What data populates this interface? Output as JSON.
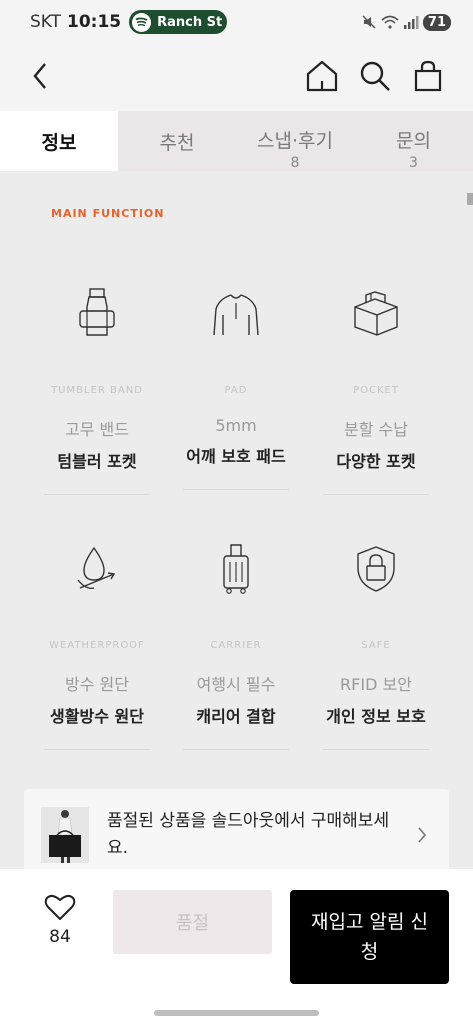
{
  "status": {
    "carrier": "SKT",
    "time": "10:15",
    "media": "Ranch St",
    "battery": "71"
  },
  "tabs": [
    {
      "label": "정보",
      "count": ""
    },
    {
      "label": "추천",
      "count": ""
    },
    {
      "label": "스냅·후기",
      "count": "8"
    },
    {
      "label": "문의",
      "count": "3"
    }
  ],
  "section_label": "MAIN FUNCTION",
  "features": [
    {
      "en": "TUMBLER BAND",
      "sub": "고무 밴드",
      "main": "텀블러 포켓",
      "icon": "tumbler-icon"
    },
    {
      "en": "PAD",
      "sub": "5mm",
      "main": "어깨 보호 패드",
      "icon": "shoulder-icon"
    },
    {
      "en": "POCKET",
      "sub": "분할 수납",
      "main": "다양한 포켓",
      "icon": "box-icon"
    },
    {
      "en": "WEATHERPROOF",
      "sub": "방수 원단",
      "main": "생활방수 원단",
      "icon": "waterdrop-icon"
    },
    {
      "en": "CARRIER",
      "sub": "여행시 필수",
      "main": "캐리어 결합",
      "icon": "suitcase-icon"
    },
    {
      "en": "SAFE",
      "sub": "RFID 보안",
      "main": "개인 정보 보호",
      "icon": "lock-shield-icon"
    }
  ],
  "banner": {
    "text": "품절된 상품을 솔드아웃에서 구매해보세요."
  },
  "bottom": {
    "like_count": "84",
    "soldout_label": "품절",
    "restock_label": "재입고 알림 신청"
  }
}
